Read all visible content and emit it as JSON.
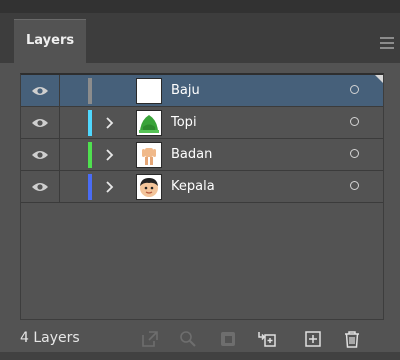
{
  "panel": {
    "tab_label": "Layers",
    "menu_icon": "hamburger-menu-icon"
  },
  "layers": [
    {
      "name": "Baju",
      "visible": true,
      "selected": true,
      "expandable": false,
      "color": "#8c8c8c",
      "thumb": "blank-white"
    },
    {
      "name": "Topi",
      "visible": true,
      "selected": false,
      "expandable": true,
      "color": "#4fd8ff",
      "thumb": "green-hat"
    },
    {
      "name": "Badan",
      "visible": true,
      "selected": false,
      "expandable": true,
      "color": "#4fe04f",
      "thumb": "body-figure"
    },
    {
      "name": "Kepala",
      "visible": true,
      "selected": false,
      "expandable": true,
      "color": "#4a6cf5",
      "thumb": "boy-face"
    }
  ],
  "footer": {
    "layer_count": "4 Layers",
    "icons": [
      "export-icon",
      "search-icon",
      "clipping-mask-icon",
      "move-to-layer-icon",
      "new-layer-icon",
      "trash-icon"
    ]
  }
}
